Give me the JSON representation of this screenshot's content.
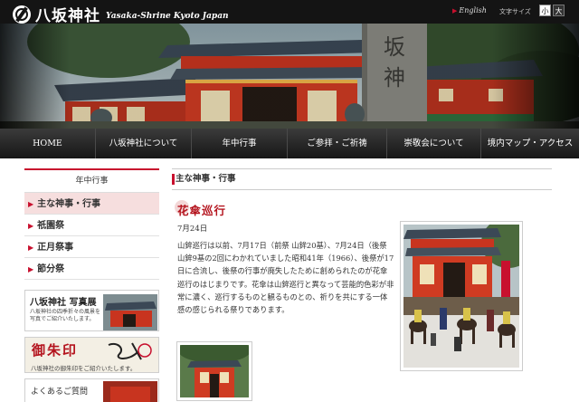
{
  "header": {
    "logo_jp": "八坂神社",
    "logo_en": "Yasaka-Shrine Kyoto Japan",
    "english_link": "English",
    "font_size_label": "文字サイズ",
    "font_small": "小",
    "font_large": "大"
  },
  "hero": {
    "gate_sign": "八坂神"
  },
  "nav": {
    "items": [
      {
        "label": "HOME"
      },
      {
        "label": "八坂神社について"
      },
      {
        "label": "年中行事"
      },
      {
        "label": "ご参拝・ご祈祷"
      },
      {
        "label": "崇敬会について"
      },
      {
        "label": "境内マップ・アクセス"
      }
    ]
  },
  "sidebar": {
    "heading": "年中行事",
    "items": [
      {
        "label": "主な神事・行事"
      },
      {
        "label": "祇園祭"
      },
      {
        "label": "正月祭事"
      },
      {
        "label": "節分祭"
      }
    ],
    "banners": [
      {
        "title": "八坂神社 写真展",
        "subtitle": "八坂神社の四季折々の風景を\n写真でご紹介いたします。"
      },
      {
        "title": "御朱印",
        "subtitle": "八坂神社の御朱印をご紹介いたします。"
      },
      {
        "title": "よくあるご質問"
      }
    ]
  },
  "main": {
    "section_title": "主な神事・行事",
    "event_title": "花傘巡行",
    "event_date": "7月24日",
    "event_body": "山鉾巡行は以前、7月17日（前祭 山鉾20基）、7月24日（後祭　　　　　山鉾9基の2回にわかれていました昭和41年（1966）、後祭が17日に合流し、後祭の行事が廃失したために創められたのが花傘巡行のはじまりです。花傘は山鉾巡行と異なって芸能的色彩が非常に濃く、巡行するものと観るものとの、祈りを共にする一体感の感じられる祭りであります。"
  }
}
